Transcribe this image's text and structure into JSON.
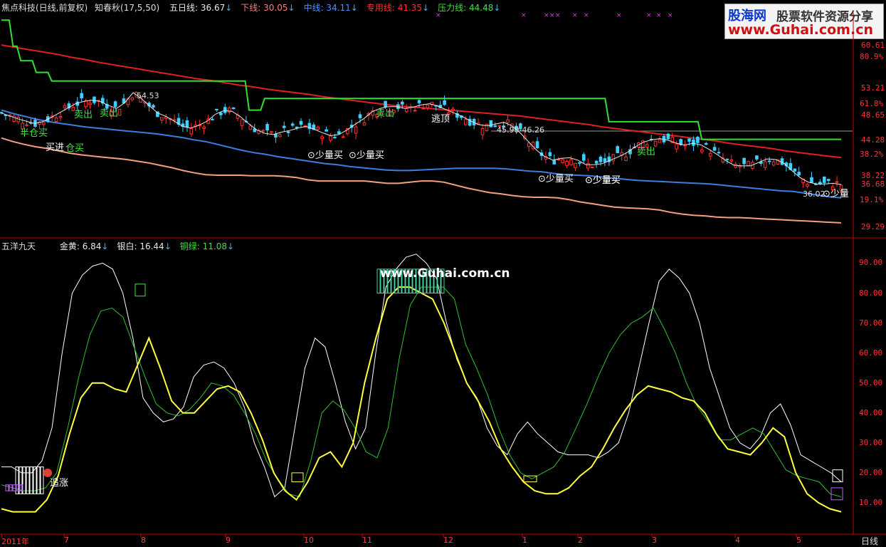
{
  "header": {
    "stock": "焦点科技(日线,前复权)",
    "indicator": "知春秋(17,5,50)",
    "items": [
      {
        "label": "五日线:",
        "value": "36.67",
        "color": "#e8e8e8"
      },
      {
        "label": "下线:",
        "value": "30.05",
        "color": "#f88080"
      },
      {
        "label": "中线:",
        "value": "34.11",
        "color": "#4a90ff"
      },
      {
        "label": "专用线:",
        "value": "41.35",
        "color": "#ff3030"
      },
      {
        "label": "压力线:",
        "value": "44.48",
        "color": "#40e040"
      }
    ]
  },
  "sub_header": {
    "title": "五洋九天",
    "items": [
      {
        "label": "金黄:",
        "value": "6.84",
        "color": "#e8e8e8"
      },
      {
        "label": "银白:",
        "value": "16.44",
        "color": "#e8e8e8"
      },
      {
        "label": "铜绿:",
        "value": "11.08",
        "color": "#40e040"
      }
    ]
  },
  "watermark": {
    "top_left": "股海网",
    "top_right": "股票软件资源分享",
    "url": "www.Guhai.com.cn",
    "center": "www.Guhai.com.cn"
  },
  "colors": {
    "up": "#ff3030",
    "down": "#40d0ff",
    "ma_white": "#e8e8e8",
    "mid_blue": "#3a7fe0",
    "low_salmon": "#f4a080",
    "special_red": "#e02020",
    "pressure_green": "#30e030",
    "gold": "#ffff40",
    "silver": "#ffffff",
    "copper": "#30c030",
    "axis": "#c00000"
  },
  "chart_data": [
    {
      "type": "candlestick",
      "title": "焦点科技(日线,前复权)",
      "y_ticks": [
        "60.61",
        "53.21",
        "48.65",
        "44.28",
        "38.22",
        "36.68",
        "29.29"
      ],
      "pct_ticks": [
        "80.9%",
        "61.8%",
        "38.2%",
        "19.1%"
      ],
      "price_labels": [
        "54.53",
        "45.90-46.26",
        "36.02"
      ],
      "annotations": [
        {
          "text": "半仓买",
          "color": "#40e040"
        },
        {
          "text": "买进",
          "color": "#ffffff"
        },
        {
          "text": "仓买",
          "color": "#40e040"
        },
        {
          "text": "卖出",
          "color": "#40e040"
        },
        {
          "text": "卖出",
          "color": "#40e040"
        },
        {
          "text": "少量买",
          "color": "#ffffff"
        },
        {
          "text": "少量买",
          "color": "#ffffff"
        },
        {
          "text": "卖出",
          "color": "#40e040"
        },
        {
          "text": "逃顶",
          "color": "#ffffff"
        },
        {
          "text": "少量买",
          "color": "#ffffff"
        },
        {
          "text": "少量买",
          "color": "#ffffff"
        },
        {
          "text": "少量买",
          "color": "#ffffff"
        },
        {
          "text": "少量",
          "color": "#ffffff"
        },
        {
          "text": "卖出",
          "color": "#40e040"
        }
      ],
      "series": [
        {
          "name": "五日线",
          "values": [
            49,
            48.5,
            48,
            47.6,
            47.2,
            47.5,
            48.2,
            49,
            49.8,
            50.6,
            51,
            51.2,
            51,
            50.3,
            49.8,
            50.8,
            52.5,
            51.5,
            50.2,
            49,
            48.4,
            47.6,
            46.7,
            46.4,
            46.9,
            47.6,
            48.8,
            49.4,
            49.3,
            48.4,
            47.2,
            46.1,
            45.5,
            45.3,
            45.7,
            46,
            46.4,
            46.7,
            46.2,
            45.6,
            45.1,
            45.3,
            46.1,
            47.1,
            48,
            49.2,
            49.8,
            50.1,
            50.1,
            49.8,
            50,
            50.4,
            50.6,
            50.2,
            49.6,
            49,
            48.4,
            47.6,
            47,
            46.8,
            47.1,
            47.4,
            46.8,
            45.6,
            44.1,
            42.6,
            41.5,
            40.9,
            41.2,
            41.3,
            40.9,
            40.1,
            40.1,
            40.3,
            40.9,
            41.5,
            42.2,
            43.2,
            44,
            44.4,
            44.6,
            44.3,
            43.8,
            43.5,
            43.8,
            43.5,
            42.7,
            41.8,
            40.8,
            40,
            39.9,
            39.9,
            40.5,
            41.1,
            41,
            40.4,
            39.1,
            37.9,
            37.1,
            36.8,
            36.8,
            36.9,
            36.7
          ]
        },
        {
          "name": "下线",
          "values": [
            44.7,
            44.1,
            43.6,
            43.2,
            42.9,
            42.5,
            42.1,
            41.8,
            41.6,
            41.4,
            41.2,
            41,
            40.7,
            40.4,
            40,
            39.6,
            39.1,
            38.7,
            38.4,
            38.3,
            38.3,
            38.3,
            38.2,
            38.2,
            38.2,
            38.1,
            37.9,
            37.5,
            37.3,
            37.3,
            37.3,
            37.3,
            37.3,
            37.1,
            36.9,
            36.9,
            37.1,
            37.3,
            37.3,
            37.1,
            36.6,
            36.1,
            35.7,
            35.3,
            35.1,
            34.8,
            34.6,
            34.5,
            34.5,
            34.4,
            34.1,
            33.7,
            33.4,
            33.1,
            32.8,
            32.7,
            32.6,
            32.5,
            32.3,
            31.9,
            31.6,
            31.4,
            31.3,
            31.1,
            31,
            31,
            30.9,
            30.8,
            30.7,
            30.6,
            30.5,
            30.4,
            30.3,
            30.2,
            30.1
          ]
        },
        {
          "name": "中线",
          "values": [
            49.5,
            48.9,
            48.4,
            47.9,
            47.5,
            47.2,
            46.9,
            46.6,
            46.4,
            46.2,
            46,
            45.8,
            45.6,
            45.4,
            45.1,
            44.8,
            44.4,
            44.1,
            43.6,
            43.1,
            42.6,
            42.2,
            41.9,
            41.5,
            41.2,
            40.9,
            40.6,
            40.3,
            40.1,
            39.8,
            39.6,
            39.4,
            39.2,
            39.1,
            39.1,
            39.2,
            39.3,
            39.4,
            39.5,
            39.5,
            39.5,
            39.5,
            39.4,
            39.2,
            39,
            38.9,
            38.6,
            38.4,
            38.3,
            38.2,
            38,
            37.8,
            37.6,
            37.4,
            37.3,
            37.2,
            37.1,
            37,
            36.9,
            36.8,
            36.6,
            36.4,
            36.2,
            36,
            35.8,
            35.6,
            35.5,
            35.2,
            34.9,
            34.6,
            34.4
          ]
        },
        {
          "name": "专用线",
          "values": [
            60.7,
            60.3,
            59.9,
            59.5,
            59.1,
            58.6,
            58.2,
            57.7,
            57.3,
            56.9,
            56.5,
            56.1,
            55.7,
            55.3,
            54.9,
            54.6,
            54.2,
            53.8,
            53.5,
            53.1,
            52.8,
            52.5,
            52.2,
            51.8,
            51.5,
            51.2,
            50.9,
            50.6,
            50.3,
            50.1,
            49.9,
            49.7,
            49.5,
            49.3,
            49.1,
            48.9,
            48.7,
            48.5,
            48.2,
            47.9,
            47.6,
            47.3,
            47,
            46.6,
            46.3,
            46,
            45.7,
            45.4,
            45.1,
            44.8,
            44.5,
            44.2,
            43.8,
            43.5,
            43.2,
            42.9,
            42.5,
            42.2,
            41.9,
            41.6,
            41.35
          ]
        },
        {
          "name": "压力线",
          "values": [
            65,
            65,
            65,
            60.5,
            60.5,
            58,
            58,
            58,
            58,
            56,
            56,
            56,
            56,
            54.5,
            54.5,
            54.5,
            54.5,
            54.5,
            54.5,
            54.5,
            54.5,
            54.5,
            54.5,
            54.5,
            54.5,
            54.5,
            54.5,
            54.5,
            54.5,
            54.5,
            54.5,
            54.5,
            54.5,
            54.5,
            54.5,
            54.5,
            54.5,
            54.5,
            54.5,
            54.5,
            54.5,
            54.5,
            54.5,
            54.5,
            54.5,
            54.5,
            54.5,
            54.5,
            54.5,
            54.5,
            54.5,
            54.5,
            54.5,
            54.5,
            54.5,
            54.5,
            54.5,
            54.5,
            54.5,
            54.5,
            54.5,
            54.5,
            54.5,
            54.5,
            49.5,
            49.5,
            49.5,
            49.5,
            51.5,
            51.5,
            51.5,
            51.5,
            51.5,
            51.5,
            51.5,
            51.5,
            51.5,
            51.5,
            51.5,
            51.5,
            51.5,
            51.5,
            51.5,
            51.5,
            51.5,
            51.5,
            51.5,
            51.5,
            51.5,
            51.5,
            51.5,
            51.5,
            51.5,
            51.5,
            51.5,
            51.5,
            51.5,
            51.5,
            51.5,
            51.5,
            51.5,
            51.5,
            51.5,
            51.5,
            51.5,
            51.5,
            51.5,
            51.5,
            51.5,
            51.5,
            51.5,
            51.5,
            51.5,
            51.5,
            51.5,
            51.5,
            51.5,
            51.5,
            51.5,
            51.5,
            51.5,
            51.5,
            51.5,
            51.5,
            51.5,
            51.5,
            51.5,
            51.5,
            51.5,
            51.5,
            51.5,
            51.5,
            51.5,
            51.5,
            51.5,
            51.5,
            51.5,
            51.5,
            51.5,
            51.5,
            51.5,
            51.5,
            51.5,
            51.5,
            51.5,
            51.5,
            51.5,
            51.5,
            51.5,
            51.5,
            51.5,
            51.5,
            51.5,
            51.5,
            51.5,
            51.5,
            51.5,
            47.5,
            47.5,
            47.5,
            47.5,
            47.5,
            47.5,
            47.5,
            47.5,
            47.5,
            47.5,
            47.5,
            47.5,
            47.5,
            47.5,
            47.5,
            47.5,
            47.5,
            47.5,
            47.5,
            47.5,
            47.5,
            47.5,
            47.5,
            47.5,
            44.48,
            44.48,
            44.48,
            44.48,
            44.48,
            44.48,
            44.48,
            44.48,
            44.48,
            44.48,
            44.48,
            44.48,
            44.48,
            44.48,
            44.48,
            44.48,
            44.48,
            44.48,
            44.48,
            44.48,
            44.48,
            44.48,
            44.48,
            44.48,
            44.48,
            44.48,
            44.48,
            44.48,
            44.48,
            44.48,
            44.48,
            44.48,
            44.48,
            44.48,
            44.48,
            44.48,
            44.48
          ]
        }
      ]
    },
    {
      "type": "line",
      "title": "五洋九天",
      "y_ticks": [
        "90.00",
        "80.00",
        "70.00",
        "60.00",
        "50.00",
        "40.00",
        "30.00",
        "20.00",
        "10.00"
      ],
      "x_ticks": [
        "2011年",
        "7",
        "8",
        "9",
        "10",
        "11",
        "12",
        "1",
        "2",
        "3",
        "4",
        "5"
      ],
      "x_axis_right": "日线",
      "annotations": [
        {
          "text": "追涨",
          "color": "#ffffff"
        }
      ],
      "series": [
        {
          "name": "银白",
          "values": [
            22,
            22,
            20,
            20,
            24,
            35,
            60,
            80,
            86,
            89,
            90,
            88,
            80,
            65,
            45,
            40,
            37,
            38,
            42,
            52,
            56,
            57,
            55,
            50,
            42,
            30,
            22,
            12,
            15,
            35,
            55,
            65,
            62,
            50,
            37,
            28,
            35,
            60,
            82,
            88,
            92,
            93,
            90,
            85,
            70,
            58,
            50,
            45,
            35,
            29,
            26,
            33,
            37,
            33,
            30,
            27,
            26,
            26,
            26,
            25,
            27,
            30,
            40,
            55,
            70,
            84,
            88,
            85,
            80,
            70,
            55,
            45,
            35,
            30,
            28,
            32,
            40,
            43,
            36,
            26,
            24,
            22,
            20,
            17
          ]
        },
        {
          "name": "铜绿",
          "values": [
            16,
            15,
            14,
            14,
            15,
            20,
            35,
            52,
            66,
            74,
            75,
            72,
            62,
            52,
            43,
            40,
            39,
            41,
            45,
            50,
            49,
            46,
            40,
            33,
            24,
            18,
            13,
            12,
            24,
            40,
            44,
            41,
            35,
            27,
            25,
            35,
            58,
            76,
            82,
            82,
            82,
            78,
            63,
            55,
            46,
            35,
            26,
            20,
            18,
            20,
            22,
            27,
            35,
            43,
            52,
            60,
            66,
            70,
            72,
            75,
            68,
            60,
            50,
            42,
            37,
            31,
            31,
            33,
            35,
            33,
            27,
            21,
            19,
            18,
            17,
            13,
            12
          ]
        },
        {
          "name": "金黄",
          "values": [
            8,
            7,
            7,
            7,
            11,
            19,
            33,
            45,
            50,
            50,
            48,
            47,
            56,
            65,
            55,
            44,
            40,
            40,
            44,
            48,
            49,
            47,
            40,
            31,
            20,
            14,
            11,
            17,
            25,
            27,
            22,
            30,
            50,
            65,
            78,
            82,
            82,
            80,
            78,
            70,
            60,
            50,
            44,
            37,
            28,
            22,
            17,
            14,
            13,
            13,
            15,
            19,
            22,
            28,
            35,
            41,
            46,
            49,
            48,
            47,
            45,
            44,
            40,
            33,
            28,
            27,
            26,
            30,
            35,
            32,
            20,
            13,
            10,
            8,
            7
          ]
        }
      ]
    }
  ]
}
